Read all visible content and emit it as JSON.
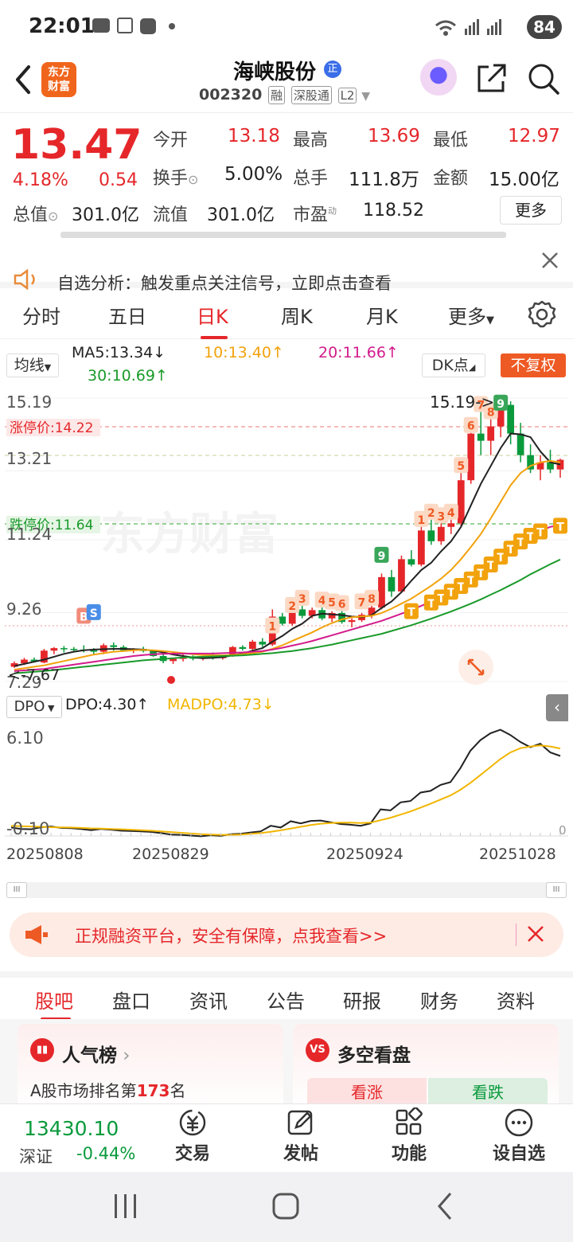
{
  "status_bar": {
    "time": "22:01",
    "battery": "84"
  },
  "header": {
    "logo_line1": "东方",
    "logo_line2": "财富",
    "stock_name": "海峡股份",
    "badge": "正",
    "stock_code": "002320",
    "tags": [
      "融",
      "深股通",
      "L2"
    ]
  },
  "quote": {
    "price": "13.47",
    "change_pct": "4.18%",
    "change_amt": "0.54",
    "open_label": "今开",
    "open": "13.18",
    "high_label": "最高",
    "high": "13.69",
    "low_label": "最低",
    "low": "12.97",
    "turnover_label": "换手",
    "turnover": "5.00%",
    "volume_label": "总手",
    "volume": "111.8万",
    "amount_label": "金额",
    "amount": "15.00亿",
    "mktcap_label": "总值",
    "mktcap": "301.0亿",
    "float_label": "流值",
    "float": "301.0亿",
    "pe_label": "市盈",
    "pe_sup": "动",
    "pe": "118.52",
    "more": "更多"
  },
  "notice": {
    "text": "自选分析：触发重点关注信号，立即点击查看"
  },
  "period_tabs": [
    "分时",
    "五日",
    "日K",
    "周K",
    "月K",
    "更多"
  ],
  "active_period": 2,
  "ma": {
    "selector": "均线",
    "ma5": "MA5:13.34↓",
    "ma10": "10:13.40↑",
    "ma20": "20:11.66↑",
    "ma30": "30:10.69↑",
    "dk": "DK点",
    "fq": "不复权",
    "colors": {
      "ma5": "#222222",
      "ma10": "#f2a20c",
      "ma20": "#d21b8c",
      "ma30": "#1a9a2a"
    }
  },
  "kchart_labels": {
    "y_top": "15.19",
    "limit_up": "涨停价:14.22",
    "y_mid": "13.21",
    "limit_down": "跌停价:11.64",
    "y_low": "11.24",
    "y_9": "9.26",
    "y_bottom": "7.29",
    "max_mark": "15.19->",
    "min_mark": "<-7.67"
  },
  "dpo": {
    "selector": "DPO",
    "dpo": "DPO:4.30↑",
    "madpo": "MADPO:4.73↓",
    "y_top": "6.10",
    "y_bottom": "-0.10",
    "y_zero": "0"
  },
  "dates": [
    "20250808",
    "20250829",
    "20250924",
    "20251028"
  ],
  "ad": {
    "text": "正规融资平台，安全有保障，点我查看>>"
  },
  "section_tabs": [
    "股吧",
    "盘口",
    "资讯",
    "公告",
    "研报",
    "财务",
    "资料"
  ],
  "cards": {
    "popular_title": "人气榜",
    "rank_prefix": "A股市场排名第",
    "rank_value": "173",
    "rank_suffix": "名",
    "longshort_title": "多空看盘",
    "bull": "看涨",
    "bear": "看跌"
  },
  "bottom": {
    "index_value": "13430.10",
    "index_name": "深证",
    "index_change": "-0.44%",
    "nav": [
      "交易",
      "发帖",
      "功能",
      "设自选"
    ]
  },
  "chart_data": {
    "type": "candlestick",
    "title": "",
    "x_range": [
      "20250808",
      "20251028"
    ],
    "ylim": [
      7.29,
      15.19
    ],
    "max_high": 15.19,
    "min_low": 7.67,
    "limit_up": 14.22,
    "limit_down": 11.64,
    "ohlc": [
      [
        7.7,
        7.85,
        7.67,
        7.8
      ],
      [
        7.8,
        7.95,
        7.75,
        7.9
      ],
      [
        7.9,
        7.96,
        7.82,
        7.85
      ],
      [
        7.82,
        8.2,
        7.8,
        8.15
      ],
      [
        8.15,
        8.25,
        8.05,
        8.22
      ],
      [
        8.22,
        8.28,
        8.1,
        8.2
      ],
      [
        8.2,
        8.25,
        8.12,
        8.18
      ],
      [
        8.18,
        8.3,
        8.1,
        8.16
      ],
      [
        8.16,
        8.22,
        8.05,
        8.12
      ],
      [
        8.12,
        8.35,
        8.05,
        8.3
      ],
      [
        8.3,
        8.38,
        8.15,
        8.25
      ],
      [
        8.25,
        8.3,
        8.12,
        8.16
      ],
      [
        8.16,
        8.22,
        8.08,
        8.2
      ],
      [
        8.2,
        8.26,
        8.1,
        8.14
      ],
      [
        8.14,
        8.18,
        7.98,
        8.0
      ],
      [
        8.0,
        8.05,
        7.8,
        7.86
      ],
      [
        7.86,
        7.95,
        7.78,
        7.92
      ],
      [
        7.92,
        8.05,
        7.85,
        7.96
      ],
      [
        7.96,
        8.02,
        7.88,
        7.94
      ],
      [
        7.94,
        8.0,
        7.88,
        7.98
      ],
      [
        7.98,
        8.1,
        7.9,
        7.94
      ],
      [
        7.94,
        8.0,
        7.9,
        8.0
      ],
      [
        8.0,
        8.28,
        7.98,
        8.25
      ],
      [
        8.25,
        8.3,
        8.15,
        8.2
      ],
      [
        8.2,
        8.45,
        8.15,
        8.4
      ],
      [
        8.4,
        8.5,
        8.25,
        8.32
      ],
      [
        8.32,
        9.3,
        8.28,
        9.1
      ],
      [
        9.1,
        9.2,
        8.85,
        8.9
      ],
      [
        8.9,
        9.4,
        8.85,
        9.3
      ],
      [
        9.3,
        9.4,
        9.05,
        9.12
      ],
      [
        9.12,
        9.35,
        9.05,
        9.28
      ],
      [
        9.28,
        9.4,
        9.0,
        9.05
      ],
      [
        9.05,
        9.25,
        8.95,
        9.2
      ],
      [
        9.2,
        9.3,
        8.9,
        8.95
      ],
      [
        8.95,
        9.05,
        8.8,
        9.0
      ],
      [
        9.0,
        9.2,
        8.95,
        9.15
      ],
      [
        9.15,
        9.4,
        9.05,
        9.35
      ],
      [
        9.35,
        10.3,
        9.3,
        10.2
      ],
      [
        10.2,
        10.4,
        9.65,
        9.8
      ],
      [
        9.8,
        10.8,
        9.75,
        10.7
      ],
      [
        10.7,
        10.95,
        10.5,
        10.55
      ],
      [
        10.55,
        11.6,
        10.5,
        11.5
      ],
      [
        11.5,
        11.8,
        11.1,
        11.2
      ],
      [
        11.2,
        11.7,
        11.1,
        11.6
      ],
      [
        11.6,
        11.8,
        11.4,
        11.7
      ],
      [
        11.7,
        13.1,
        11.6,
        12.9
      ],
      [
        12.9,
        14.22,
        12.8,
        14.2
      ],
      [
        14.2,
        14.8,
        13.6,
        14.0
      ],
      [
        14.0,
        14.6,
        13.6,
        14.4
      ],
      [
        14.4,
        15.19,
        14.1,
        15.0
      ],
      [
        15.0,
        15.1,
        13.9,
        14.2
      ],
      [
        14.2,
        14.5,
        13.4,
        13.6
      ],
      [
        13.6,
        13.9,
        13.1,
        13.2
      ],
      [
        13.2,
        13.6,
        12.9,
        13.4
      ],
      [
        13.4,
        13.75,
        13.1,
        13.2
      ],
      [
        13.2,
        13.5,
        12.97,
        13.47
      ]
    ],
    "ma": {
      "MA5": [
        7.72,
        7.78,
        7.84,
        7.9,
        7.98,
        8.06,
        8.12,
        8.16,
        8.18,
        8.19,
        8.2,
        8.2,
        8.19,
        8.18,
        8.15,
        8.1,
        8.04,
        8.0,
        7.96,
        7.94,
        7.95,
        7.97,
        8.02,
        8.07,
        8.15,
        8.22,
        8.4,
        8.56,
        8.76,
        8.9,
        9.12,
        9.18,
        9.16,
        9.14,
        9.1,
        9.08,
        9.14,
        9.34,
        9.52,
        9.78,
        10.1,
        10.4,
        10.6,
        10.92,
        11.2,
        11.6,
        12.2,
        12.8,
        13.3,
        13.8,
        14.2,
        14.18,
        14.1,
        13.7,
        13.4,
        13.34
      ],
      "MA10": [
        7.62,
        7.66,
        7.7,
        7.74,
        7.8,
        7.86,
        7.92,
        7.98,
        8.04,
        8.08,
        8.12,
        8.14,
        8.16,
        8.17,
        8.16,
        8.14,
        8.11,
        8.08,
        8.05,
        8.03,
        8.02,
        8.02,
        8.03,
        8.05,
        8.08,
        8.12,
        8.2,
        8.3,
        8.42,
        8.54,
        8.66,
        8.8,
        8.92,
        9.02,
        9.08,
        9.1,
        9.12,
        9.2,
        9.32,
        9.46,
        9.6,
        9.78,
        9.96,
        10.16,
        10.4,
        10.7,
        11.04,
        11.4,
        11.84,
        12.3,
        12.76,
        13.1,
        13.3,
        13.4,
        13.44,
        13.4
      ],
      "MA20": [
        7.58,
        7.6,
        7.62,
        7.64,
        7.68,
        7.72,
        7.76,
        7.8,
        7.84,
        7.88,
        7.92,
        7.96,
        8.0,
        8.03,
        8.05,
        8.06,
        8.07,
        8.07,
        8.07,
        8.07,
        8.07,
        8.08,
        8.09,
        8.1,
        8.12,
        8.14,
        8.18,
        8.23,
        8.29,
        8.35,
        8.42,
        8.5,
        8.58,
        8.66,
        8.74,
        8.82,
        8.9,
        8.98,
        9.08,
        9.18,
        9.28,
        9.4,
        9.52,
        9.66,
        9.82,
        9.98,
        10.16,
        10.36,
        10.58,
        10.8,
        11.02,
        11.22,
        11.38,
        11.5,
        11.6,
        11.66
      ],
      "MA30": [
        7.52,
        7.54,
        7.56,
        7.58,
        7.61,
        7.64,
        7.67,
        7.7,
        7.73,
        7.76,
        7.79,
        7.82,
        7.85,
        7.88,
        7.9,
        7.92,
        7.94,
        7.96,
        7.97,
        7.98,
        7.99,
        8.0,
        8.01,
        8.02,
        8.04,
        8.06,
        8.08,
        8.11,
        8.14,
        8.18,
        8.22,
        8.27,
        8.32,
        8.38,
        8.44,
        8.5,
        8.56,
        8.62,
        8.7,
        8.78,
        8.86,
        8.95,
        9.04,
        9.14,
        9.24,
        9.35,
        9.46,
        9.58,
        9.71,
        9.84,
        9.98,
        10.12,
        10.28,
        10.42,
        10.56,
        10.69
      ]
    },
    "dpo_series": {
      "ylim": [
        -0.1,
        6.1
      ],
      "DPO": [
        0.2,
        0.12,
        0.1,
        0.22,
        0.26,
        0.18,
        0.16,
        0.12,
        0.05,
        0.12,
        0.08,
        0.02,
        0.0,
        -0.02,
        -0.05,
        -0.12,
        -0.2,
        -0.22,
        -0.26,
        -0.3,
        -0.24,
        -0.28,
        -0.18,
        -0.16,
        -0.08,
        -0.02,
        0.3,
        0.2,
        0.56,
        0.44,
        0.58,
        0.6,
        0.5,
        0.4,
        0.36,
        0.3,
        0.44,
        1.24,
        1.18,
        1.64,
        1.72,
        2.2,
        2.3,
        2.64,
        2.8,
        3.6,
        4.6,
        5.2,
        5.6,
        5.8,
        5.5,
        5.1,
        4.8,
        5.0,
        4.5,
        4.3
      ],
      "MADPO": [
        0.3,
        0.28,
        0.26,
        0.24,
        0.22,
        0.21,
        0.2,
        0.18,
        0.15,
        0.14,
        0.12,
        0.1,
        0.08,
        0.05,
        0.02,
        -0.02,
        -0.06,
        -0.1,
        -0.14,
        -0.18,
        -0.2,
        -0.22,
        -0.22,
        -0.2,
        -0.16,
        -0.12,
        -0.04,
        0.04,
        0.14,
        0.24,
        0.34,
        0.42,
        0.46,
        0.48,
        0.48,
        0.46,
        0.48,
        0.62,
        0.76,
        0.94,
        1.12,
        1.34,
        1.56,
        1.8,
        2.04,
        2.36,
        2.76,
        3.2,
        3.66,
        4.12,
        4.5,
        4.74,
        4.84,
        4.9,
        4.84,
        4.73
      ],
      "colors": {
        "DPO": "#222222",
        "MADPO": "#f2b600"
      }
    }
  }
}
